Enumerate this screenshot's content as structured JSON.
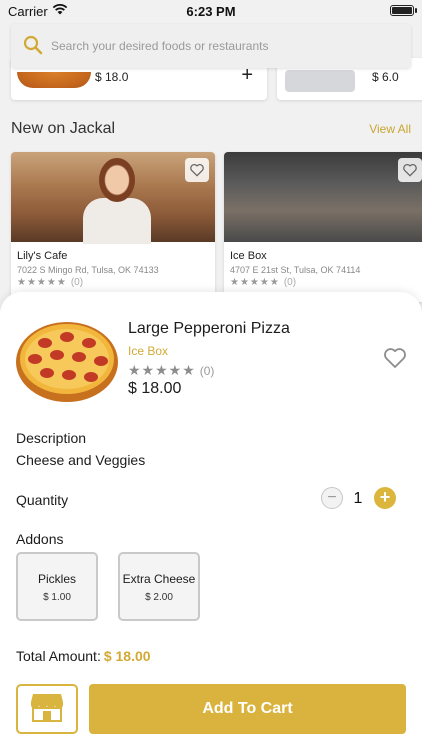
{
  "status_bar": {
    "carrier": "Carrier",
    "time": "6:23 PM",
    "battery_level": 0.9
  },
  "search": {
    "placeholder": "Search your desired foods or restaurants",
    "icon": "search-icon"
  },
  "top_cards": [
    {
      "price": "$ 18.0",
      "action": "+"
    },
    {
      "price": "$ 6.0"
    }
  ],
  "section": {
    "title": "New on Jackal",
    "view_all": "View All"
  },
  "restaurants": [
    {
      "name": "Lily's Cafe",
      "address": "7022 S Mingo Rd, Tulsa, OK 74133",
      "stars": "★★★★★",
      "rating_count": "(0)"
    },
    {
      "name": "Ice Box",
      "address": "4707 E 21st St, Tulsa, OK 74114",
      "stars": "★★★★★",
      "rating_count": "(0)"
    }
  ],
  "item": {
    "name": "Large Pepperoni Pizza",
    "restaurant": "Ice Box",
    "stars": "★★★★★",
    "rating_count": "(0)",
    "price": "$ 18.00",
    "description_label": "Description",
    "description": "Cheese and Veggies",
    "quantity_label": "Quantity",
    "quantity": "1",
    "minus": "−",
    "plus": "+",
    "addons_label": "Addons",
    "addons": [
      {
        "name": "Pickles",
        "price": "$ 1.00"
      },
      {
        "name": "Extra Cheese",
        "price": "$ 2.00"
      }
    ],
    "total_label": "Total Amount:",
    "total": "$ 18.00"
  },
  "actions": {
    "add_to_cart": "Add To Cart",
    "store_icon": "store-icon"
  },
  "colors": {
    "accent": "#dab33e",
    "accent_text": "#d3a935",
    "background": "#f1f1f1"
  }
}
